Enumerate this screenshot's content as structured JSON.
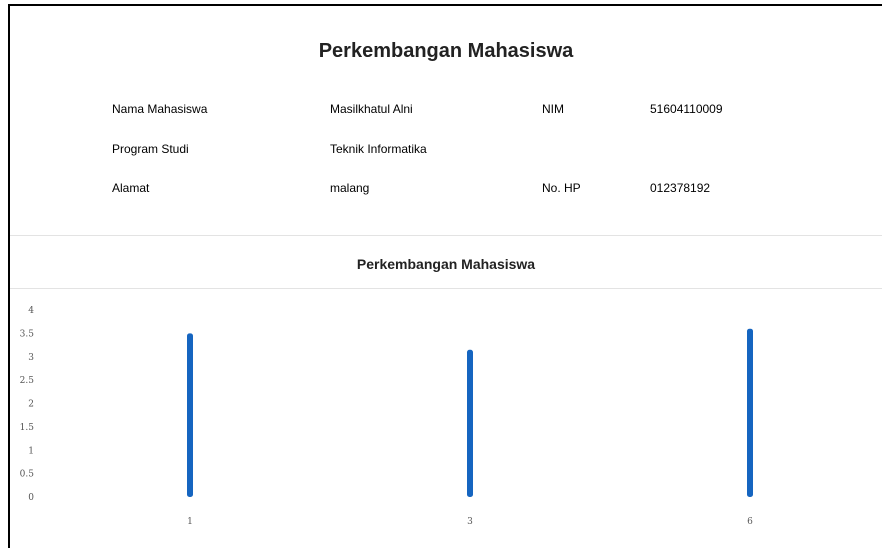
{
  "page": {
    "title": "Perkembangan Mahasiswa"
  },
  "student": {
    "name_label": "Nama Mahasiswa",
    "name_value": "Masilkhatul Alni",
    "nim_label": "NIM",
    "nim_value": "51604110009",
    "program_label": "Program Studi",
    "program_value": "Teknik Informatika",
    "address_label": "Alamat",
    "address_value": "malang",
    "phone_label": "No. HP",
    "phone_value": "012378192"
  },
  "chart_data": {
    "type": "bar",
    "title": "Perkembangan Mahasiswa",
    "categories": [
      "1",
      "3",
      "6"
    ],
    "values": [
      3.5,
      3.15,
      3.6
    ],
    "y_ticks": [
      "0",
      "0.5",
      "1",
      "1.5",
      "2",
      "2.5",
      "3",
      "3.5",
      "4"
    ],
    "ylim": [
      0,
      4
    ],
    "bar_color": "#1565c0",
    "grid": false,
    "xlabel": "",
    "ylabel": ""
  }
}
